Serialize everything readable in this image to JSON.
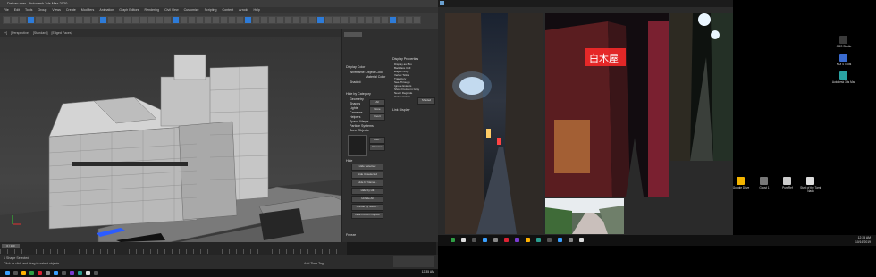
{
  "left_window": {
    "title": "Daisan.max - Autodesk 3ds Max 2020",
    "menu": [
      "File",
      "Edit",
      "Tools",
      "Group",
      "Views",
      "Create",
      "Modifiers",
      "Animation",
      "Graph Editors",
      "Rendering",
      "Civil View",
      "Customize",
      "Scripting",
      "Content",
      "Arnold",
      "Help"
    ],
    "viewport_tabs": [
      "[+]",
      "[Perspective]",
      "[Standard]",
      "[Edged Faces]"
    ],
    "panel": {
      "display_color": "Display Color",
      "wireframe": "Wireframe:",
      "object_color": "Object Color",
      "material_color": "Material Color",
      "shaded": "Shaded:",
      "hide_by_category": "Hide by Category",
      "categories": [
        "Geometry",
        "Shapes",
        "Lights",
        "Cameras",
        "Helpers",
        "Space Warps",
        "Particle Systems",
        "Bone Objects"
      ],
      "all": "All",
      "none": "None",
      "invert": "Invert",
      "add": "Add...",
      "remove": "Remove",
      "hide_section": "Hide",
      "hide_buttons": [
        "Hide Selected",
        "Hide Unselected",
        "Hide by Name...",
        "Hide by Hit",
        "Unhide All",
        "Unhide by Name...",
        "Hide Frozen Objects"
      ],
      "freeze": "Freeze",
      "display_properties": "Display Properties",
      "props": [
        "Display as Box",
        "Backface Cull",
        "Edges Only",
        "Vertex Ticks",
        "Trajectory",
        "See-Through",
        "Ignore Extents",
        "Show Frozen in Gray",
        "Never Degrade",
        "Vertex Colors"
      ],
      "shaded_btn": "Shaded",
      "link_display": "Link Display"
    },
    "timeline_frame": "0 / 100",
    "status": {
      "selection": "1 Shape Selected",
      "hint": "Click or click-and-drag to select objects",
      "add_time_tag": "Add Time Tag"
    },
    "tray_time": "12:35 AM"
  },
  "desktop": {
    "icons": [
      {
        "label": "OBS Studio",
        "color": "#3a3a3a"
      },
      {
        "label": "NDI 4 Tools",
        "color": "#3a6bd0"
      },
      {
        "label": "Autodesk 3ds Max",
        "color": "#2aa3a3"
      }
    ],
    "bottom_icons": [
      {
        "label": "Google Drive",
        "color": "#f4b400"
      },
      {
        "label": "Ghost 1",
        "color": "#777"
      },
      {
        "label": "PureRef",
        "color": "#cccccc"
      },
      {
        "label": "Start of the Tamil Nadu",
        "color": "#dddddd"
      }
    ],
    "sign_text": "白木屋",
    "tray_time": "12:35 AM",
    "tray_date": "10/16/2019"
  },
  "colors": {
    "accent": "#00a8e8",
    "taskbar": "#111111"
  }
}
